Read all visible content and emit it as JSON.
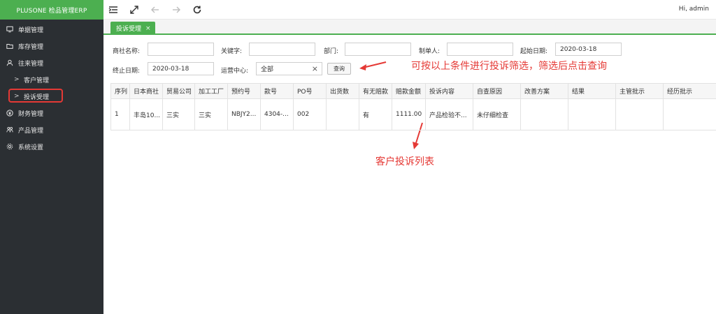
{
  "app": {
    "brand": "PLUSONE 检品管理ERP",
    "greeting": "Hi, admin"
  },
  "sidebar": {
    "items": [
      {
        "label": "单据管理",
        "icon": "monitor-icon"
      },
      {
        "label": "库存管理",
        "icon": "folder-icon"
      },
      {
        "label": "往来管理",
        "icon": "user-icon"
      },
      {
        "label": "客户管理",
        "icon": "chevron-right-icon",
        "sub": true
      },
      {
        "label": "投诉受理",
        "icon": "chevron-right-icon",
        "sub": true,
        "active": true
      },
      {
        "label": "财务管理",
        "icon": "yen-icon"
      },
      {
        "label": "产品管理",
        "icon": "people-icon"
      },
      {
        "label": "系统设置",
        "icon": "gear-icon"
      }
    ],
    "highlight_color": "#e53935"
  },
  "topbar": {
    "icons": [
      "menu-icon",
      "expand-icon",
      "back-arrow-icon",
      "forward-arrow-icon",
      "refresh-icon"
    ]
  },
  "tabs": [
    {
      "label": "投诉受理",
      "close": "×",
      "active": true
    }
  ],
  "filters": {
    "firm_name": {
      "label": "商社名称:",
      "value": ""
    },
    "keyword": {
      "label": "关键字:",
      "value": ""
    },
    "department": {
      "label": "部门:",
      "value": ""
    },
    "creator": {
      "label": "制单人:",
      "value": ""
    },
    "start_date": {
      "label": "起始日期:",
      "value": "2020-03-18"
    },
    "end_date": {
      "label": "终止日期:",
      "value": "2020-03-18"
    },
    "ops_center": {
      "label": "运营中心:",
      "value": "全部",
      "clear": "⨯"
    },
    "query_button": "查询"
  },
  "table": {
    "columns": [
      "序列",
      "日本商社",
      "贸易公司",
      "加工工厂",
      "预约号",
      "款号",
      "PO号",
      "出货数",
      "有无赔款",
      "赔款金额",
      "投诉内容",
      "自查原因",
      "改善方案",
      "结果",
      "主管批示",
      "经历批示"
    ],
    "rows": [
      [
        "1",
        "丰岛10...",
        "三实",
        "三实",
        "NBJY2...",
        "4304-...",
        "002",
        "",
        "有",
        "1111.00",
        "产品检验不...",
        "未仔细检查",
        "",
        "",
        "",
        ""
      ]
    ]
  },
  "annotations": {
    "filter_hint": "可按以上条件进行投诉筛选，筛选后点击查询",
    "list_hint": "客户投诉列表",
    "color": "#e53935"
  },
  "colors": {
    "accent": "#4caf50",
    "sidebar_bg": "#2b2f33"
  }
}
